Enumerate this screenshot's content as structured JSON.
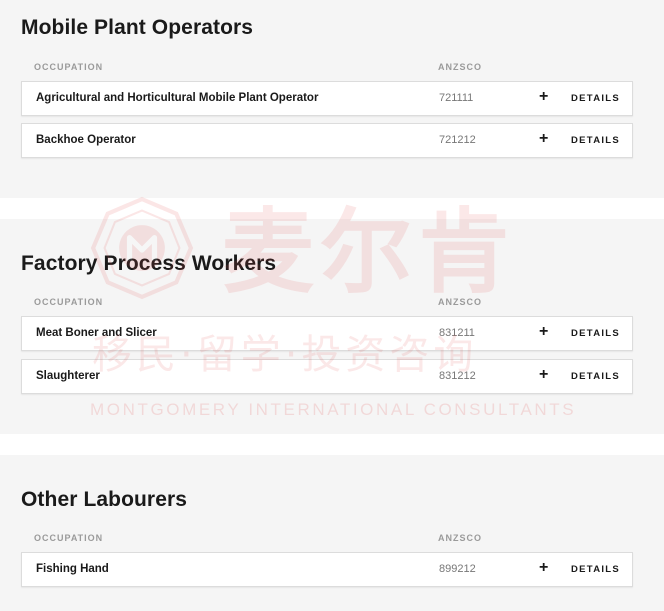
{
  "columns": {
    "occupation": "OCCUPATION",
    "anzsco": "ANZSCO"
  },
  "row_actions": {
    "expand": "+",
    "details": "DETAILS"
  },
  "sections": [
    {
      "title": "Mobile Plant Operators",
      "rows": [
        {
          "name": "Agricultural and Horticultural Mobile Plant Operator",
          "code": "721111"
        },
        {
          "name": "Backhoe Operator",
          "code": "721212"
        }
      ]
    },
    {
      "title": "Factory Process Workers",
      "rows": [
        {
          "name": "Meat Boner and Slicer",
          "code": "831211"
        },
        {
          "name": "Slaughterer",
          "code": "831212"
        }
      ]
    },
    {
      "title": "Other Labourers",
      "rows": [
        {
          "name": "Fishing Hand",
          "code": "899212"
        }
      ]
    }
  ],
  "watermark": {
    "brand_cn": "麦尔肯",
    "tagline_cn": "移民·留学·投资咨询",
    "brand_en": "MONTGOMERY INTERNATIONAL CONSULTANTS"
  }
}
